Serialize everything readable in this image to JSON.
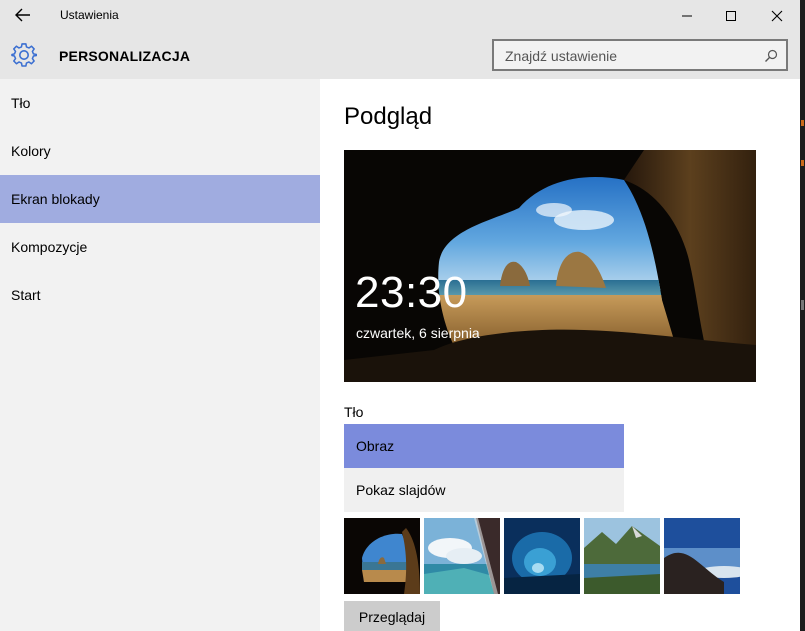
{
  "window": {
    "title": "Ustawienia"
  },
  "header": {
    "section_title": "PERSONALIZACJA",
    "search": {
      "placeholder": "Znajdź ustawienie"
    }
  },
  "sidebar": {
    "items": [
      {
        "label": "Tło",
        "active": false
      },
      {
        "label": "Kolory",
        "active": false
      },
      {
        "label": "Ekran blokady",
        "active": true
      },
      {
        "label": "Kompozycje",
        "active": false
      },
      {
        "label": "Start",
        "active": false
      }
    ]
  },
  "main": {
    "preview_title": "Podgląd",
    "lock_screen": {
      "time": "23:30",
      "date": "czwartek, 6 sierpnia"
    },
    "background": {
      "label": "Tło",
      "options": [
        {
          "label": "Obraz",
          "selected": true
        },
        {
          "label": "Pokaz slajdów",
          "selected": false
        }
      ]
    },
    "thumbnails": [
      "beach-cave-thumbnail",
      "sky-wing-thumbnail",
      "ice-cave-thumbnail",
      "mountain-lake-thumbnail",
      "hill-sky-thumbnail"
    ],
    "browse_label": "Przeglądaj"
  },
  "colors": {
    "accent_selected": "#7b8bdc",
    "sidebar_active": "#a0ace0",
    "gear_icon": "#3b6fd1"
  }
}
